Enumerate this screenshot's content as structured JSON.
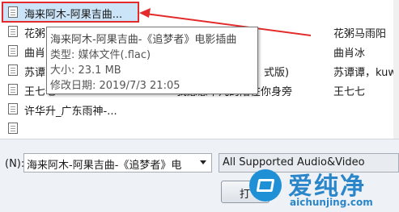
{
  "file_list": {
    "rows": [
      {
        "name": "海来阿木-阿果吉曲...",
        "artist": ""
      },
      {
        "name": "花粥",
        "artist": "花粥马雨阳"
      },
      {
        "name": "曲肖",
        "artist": "曲肖冰"
      },
      {
        "name": "苏谭",
        "artist": "苏谭谭，kuwo"
      },
      {
        "name": "王七七",
        "artist": "王七七"
      },
      {
        "name": "许华升_广东雨神-...",
        "artist": ""
      },
      {
        "name": "",
        "artist": ""
      }
    ],
    "partial_texts": {
      "row4_mid": "式版)",
      "row5_mid": "我愿意平凡的陪在你身旁"
    }
  },
  "tooltip": {
    "title": "海来阿木-阿果吉曲-《追梦者》电影插曲",
    "type": "类型: 媒体文件(.flac)",
    "size": "大小: 23.1 MB",
    "modified": "修改日期: 2019/7/3 21:05"
  },
  "bottom": {
    "filename_label": "(N):",
    "filename_value": "海来阿木-阿果吉曲-《追梦者》电",
    "filetype_value": "All Supported Audio&Video",
    "open_label": "打"
  },
  "watermark": {
    "title": "爱纯净",
    "url": "aichunjing.com"
  },
  "colors": {
    "annotation": "#e32b2b",
    "selection": "#cce4f7",
    "brand": "#2a86c9"
  },
  "icons": [
    "file-icon",
    "dropdown-arrow-icon",
    "annotation-arrow-icon",
    "brand-logo-icon"
  ]
}
